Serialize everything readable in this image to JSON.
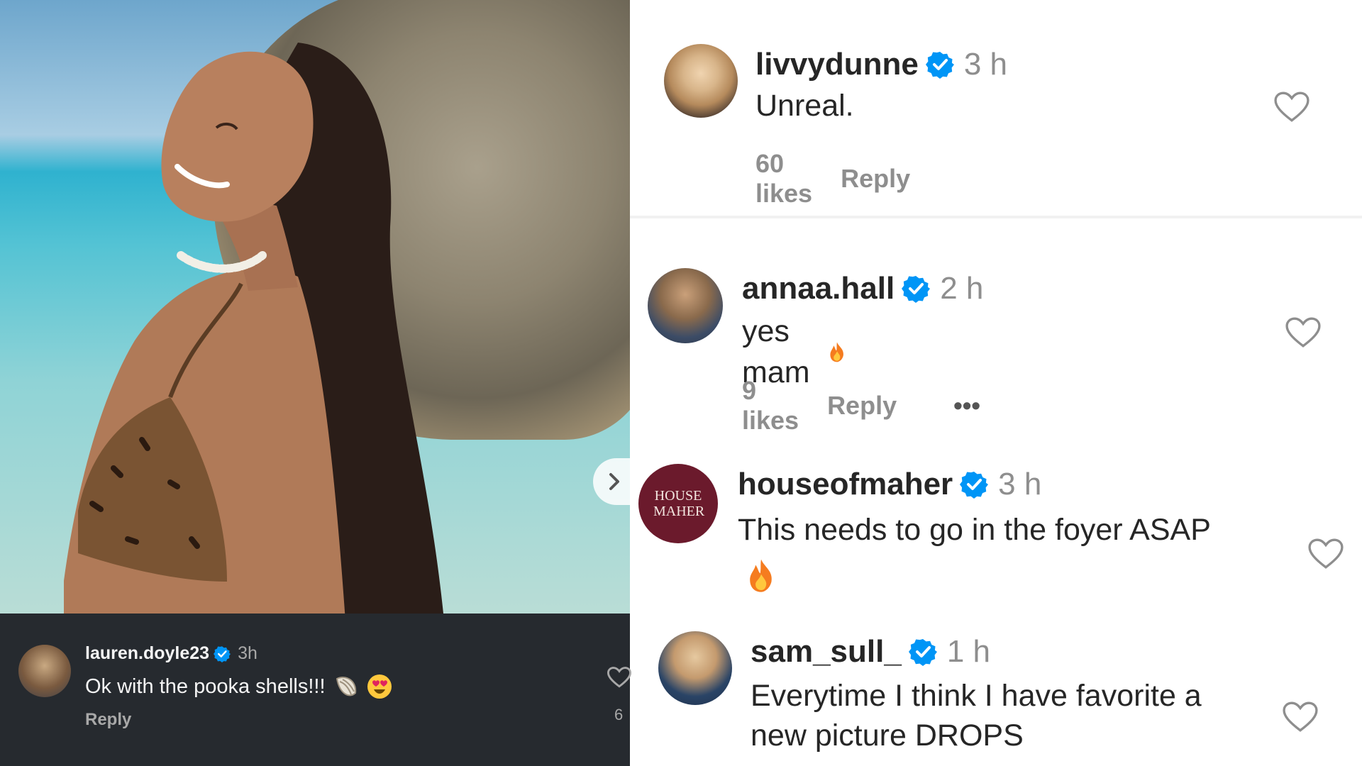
{
  "dark_comment": {
    "username": "lauren.doyle23",
    "time": "3h",
    "text": "Ok with the pooka shells!!!",
    "reply_label": "Reply",
    "like_count": "6"
  },
  "comments": [
    {
      "username": "livvydunne",
      "time": "3 h",
      "text": "Unreal.",
      "likes": "60 likes",
      "reply_label": "Reply"
    },
    {
      "username": "annaa.hall",
      "time": "2 h",
      "text": "yes mam",
      "likes": "9 likes",
      "reply_label": "Reply",
      "more_label": "•••"
    },
    {
      "username": "houseofmaher",
      "time": "3 h",
      "text_line1": "This needs to go in the foyer ASAP",
      "avatar_text": "HOUSE MAHER"
    },
    {
      "username": "sam_sull_",
      "time": "1 h",
      "text_line1": "Everytime I think I have favorite a",
      "text_line2": "new picture DROPS"
    }
  ],
  "colors": {
    "verified": "#0095f6",
    "dark_bg": "#262a2f",
    "maher_bg": "#6b1a2c",
    "fire": "#f57c1f"
  },
  "icons": [
    "verified-badge-icon",
    "heart-icon",
    "fire-emoji-icon",
    "shell-emoji-icon",
    "heart-eyes-emoji-icon",
    "chevron-right-icon"
  ]
}
